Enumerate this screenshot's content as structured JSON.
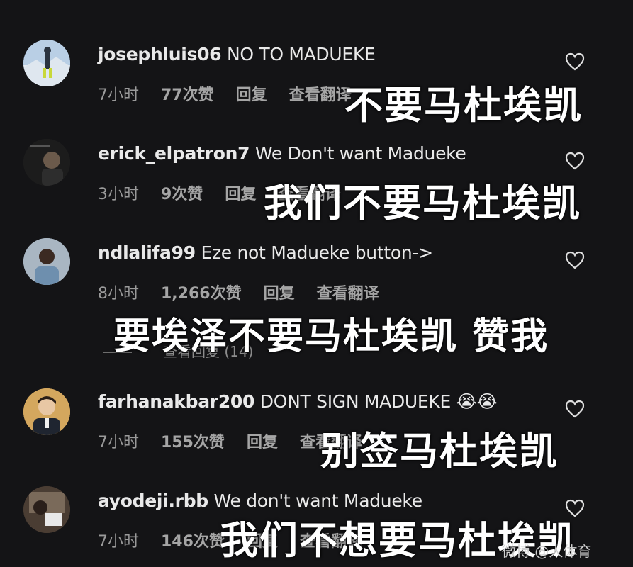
{
  "comments": [
    {
      "username": "josephluis06",
      "text": "NO TO MADUEKE",
      "time": "7小时",
      "likes": "77次赞",
      "reply": "回复",
      "translate": "查看翻译",
      "overlay": "不要马杜埃凯"
    },
    {
      "username": "erick_elpatron7",
      "text": "We Don't want Madueke",
      "time": "3小时",
      "likes": "9次赞",
      "reply": "回复",
      "translate": "查看翻译",
      "overlay": "我们不要马杜埃凯"
    },
    {
      "username": "ndlalifa99",
      "text": "Eze not Madueke button->",
      "time": "8小时",
      "likes": "1,266次赞",
      "reply": "回复",
      "translate": "查看翻译",
      "overlay": "要埃泽不要马杜埃凯 赞我",
      "view_replies": "查看回复 (14)"
    },
    {
      "username": "farhanakbar200",
      "text": "DONT SIGN MADUEKE 😭😭",
      "time": "7小时",
      "likes": "155次赞",
      "reply": "回复",
      "translate": "查看翻译",
      "overlay": "别签马杜埃凯"
    },
    {
      "username": "ayodeji.rbb",
      "text": "We don't want Madueke",
      "time": "7小时",
      "likes": "146次赞",
      "reply": "回复",
      "translate": "查看翻译",
      "overlay": "我们不想要马杜埃凯"
    }
  ],
  "watermark": "微博 @人体育",
  "icons": {
    "like": "heart-outline-icon",
    "avatar": "user-avatar"
  },
  "colors": {
    "background": "#141416",
    "primary_text": "#e9e9e9",
    "secondary_text": "#9a9a9a",
    "overlay_text": "#ffffff"
  }
}
